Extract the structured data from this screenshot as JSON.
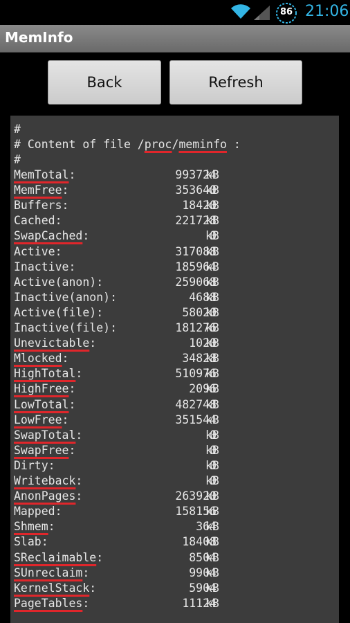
{
  "status_bar": {
    "time": "21:06",
    "battery": "86",
    "icons": [
      "wifi-icon",
      "signal-icon",
      "battery-icon"
    ],
    "accent": "#33b5e5"
  },
  "app": {
    "title": "MemInfo"
  },
  "buttons": {
    "back": "Back",
    "refresh": "Refresh"
  },
  "header": {
    "line1": "#",
    "line2_prefix": "# Content of file /",
    "line2_proc": "proc",
    "line2_slash": "/",
    "line2_meminfo": "meminfo",
    "line2_suffix": " :",
    "line3": "#"
  },
  "meminfo": [
    {
      "key": "MemTotal",
      "value": "993724",
      "unit": "kB"
    },
    {
      "key": "MemFree",
      "value": "353640",
      "unit": "kB"
    },
    {
      "key": "Buffers",
      "value": "18420",
      "unit": "kB"
    },
    {
      "key": "Cached",
      "value": "221728",
      "unit": "kB"
    },
    {
      "key": "SwapCached",
      "value": "0",
      "unit": "kB"
    },
    {
      "key": "Active",
      "value": "317088",
      "unit": "kB"
    },
    {
      "key": "Inactive",
      "value": "185964",
      "unit": "kB"
    },
    {
      "key": "Active(anon)",
      "value": "259068",
      "unit": "kB"
    },
    {
      "key": "Inactive(anon)",
      "value": "4688",
      "unit": "kB"
    },
    {
      "key": "Active(file)",
      "value": "58020",
      "unit": "kB"
    },
    {
      "key": "Inactive(file)",
      "value": "181276",
      "unit": "kB"
    },
    {
      "key": "Unevictable",
      "value": "1020",
      "unit": "kB"
    },
    {
      "key": "Mlocked",
      "value": "34828",
      "unit": "kB"
    },
    {
      "key": "HighTotal",
      "value": "510976",
      "unit": "kB"
    },
    {
      "key": "HighFree",
      "value": "2096",
      "unit": "kB"
    },
    {
      "key": "LowTotal",
      "value": "482748",
      "unit": "kB"
    },
    {
      "key": "LowFree",
      "value": "351544",
      "unit": "kB"
    },
    {
      "key": "SwapTotal",
      "value": "0",
      "unit": "kB"
    },
    {
      "key": "SwapFree",
      "value": "0",
      "unit": "kB"
    },
    {
      "key": "Dirty",
      "value": "0",
      "unit": "kB"
    },
    {
      "key": "Writeback",
      "value": "0",
      "unit": "kB"
    },
    {
      "key": "AnonPages",
      "value": "263920",
      "unit": "kB"
    },
    {
      "key": "Mapped",
      "value": "158156",
      "unit": "kB"
    },
    {
      "key": "Shmem",
      "value": "364",
      "unit": "kB"
    },
    {
      "key": "Slab",
      "value": "18408",
      "unit": "kB"
    },
    {
      "key": "SReclaimable",
      "value": "8504",
      "unit": "kB"
    },
    {
      "key": "SUnreclaim",
      "value": "9904",
      "unit": "kB"
    },
    {
      "key": "KernelStack",
      "value": "5904",
      "unit": "kB"
    },
    {
      "key": "PageTables",
      "value": "11124",
      "unit": "kB"
    }
  ],
  "spellcheck_underline_color": "#e0262b"
}
